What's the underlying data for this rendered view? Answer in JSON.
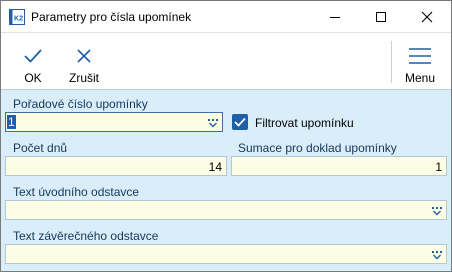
{
  "window": {
    "title": "Parametry pro čísla upomínek",
    "app_icon_text": "K2"
  },
  "toolbar": {
    "ok_label": "OK",
    "cancel_label": "Zrušit",
    "menu_label": "Menu"
  },
  "form": {
    "order_number": {
      "label": "Pořadové číslo upomínky",
      "value": "1"
    },
    "filter_checkbox": {
      "label": "Filtrovat upomínku",
      "checked": true
    },
    "day_count": {
      "label": "Počet dnů",
      "value": "14"
    },
    "summation": {
      "label": "Sumace pro doklad upomínky",
      "value": "1"
    },
    "intro_text": {
      "label": "Text úvodního odstavce",
      "value": ""
    },
    "closing_text": {
      "label": "Text závěrečného odstavce",
      "value": ""
    }
  },
  "colors": {
    "form_background": "#d9eef8",
    "field_background": "#fdfde6",
    "accent": "#1f5fa6",
    "label_text": "#17365d"
  }
}
